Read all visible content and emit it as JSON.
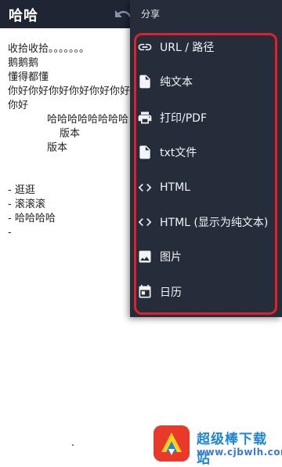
{
  "app": {
    "title": "哈哈"
  },
  "note": {
    "lines": [
      "收拾收拾。。。。。。。",
      "鹅鹅鹅",
      "懂得都懂",
      "你好你好你好你好你好你好",
      "你好",
      "哈哈哈哈哈哈哈哈",
      "版本",
      "版本"
    ],
    "list": [
      "- 逛逛",
      "- 滚滚滚",
      "- 哈哈哈哈",
      "-"
    ]
  },
  "share_menu": {
    "header": "分享",
    "items": [
      {
        "label": "URL / 路径",
        "icon": "link-icon"
      },
      {
        "label": "纯文本",
        "icon": "document-icon"
      },
      {
        "label": "打印/PDF",
        "icon": "printer-icon"
      },
      {
        "label": "txt文件",
        "icon": "document-icon"
      },
      {
        "label": "HTML",
        "icon": "code-icon"
      },
      {
        "label": "HTML (显示为纯文本)",
        "icon": "code-icon"
      },
      {
        "label": "图片",
        "icon": "image-icon"
      },
      {
        "label": "日历",
        "icon": "calendar-icon"
      }
    ],
    "highlight_color": "#e0202a"
  },
  "watermark": {
    "title": "超级棒下载站",
    "url": "www.cjbwlh.com"
  },
  "colors": {
    "appbar": "#1f2533",
    "menu_bg": "#252d3a",
    "menu_text": "#f2f4f7"
  }
}
